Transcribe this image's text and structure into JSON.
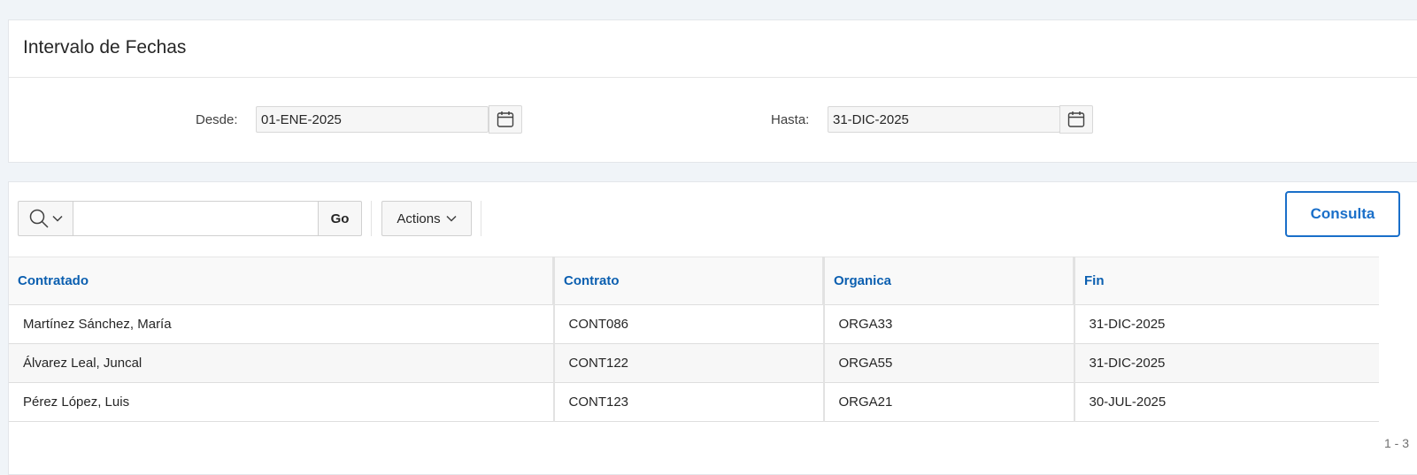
{
  "date_range": {
    "title": "Intervalo de Fechas",
    "from_label": "Desde:",
    "from_value": "01-ENE-2025",
    "to_label": "Hasta:",
    "to_value": "31-DIC-2025"
  },
  "toolbar": {
    "search_value": "",
    "go_label": "Go",
    "actions_label": "Actions",
    "consulta_label": "Consulta"
  },
  "table": {
    "columns": [
      "Contratado",
      "Contrato",
      "Organica",
      "Fin"
    ],
    "rows": [
      [
        "Martínez Sánchez, María",
        "CONT086",
        "ORGA33",
        "31-DIC-2025"
      ],
      [
        "Álvarez Leal, Juncal",
        "CONT122",
        "ORGA55",
        "31-DIC-2025"
      ],
      [
        "Pérez López, Luis",
        "CONT123",
        "ORGA21",
        "30-JUL-2025"
      ]
    ]
  },
  "pagination": {
    "text": "1 - 3"
  },
  "colors": {
    "accent": "#1a6fc9",
    "header_text": "#0b5fb0",
    "background": "#f0f4f8"
  }
}
